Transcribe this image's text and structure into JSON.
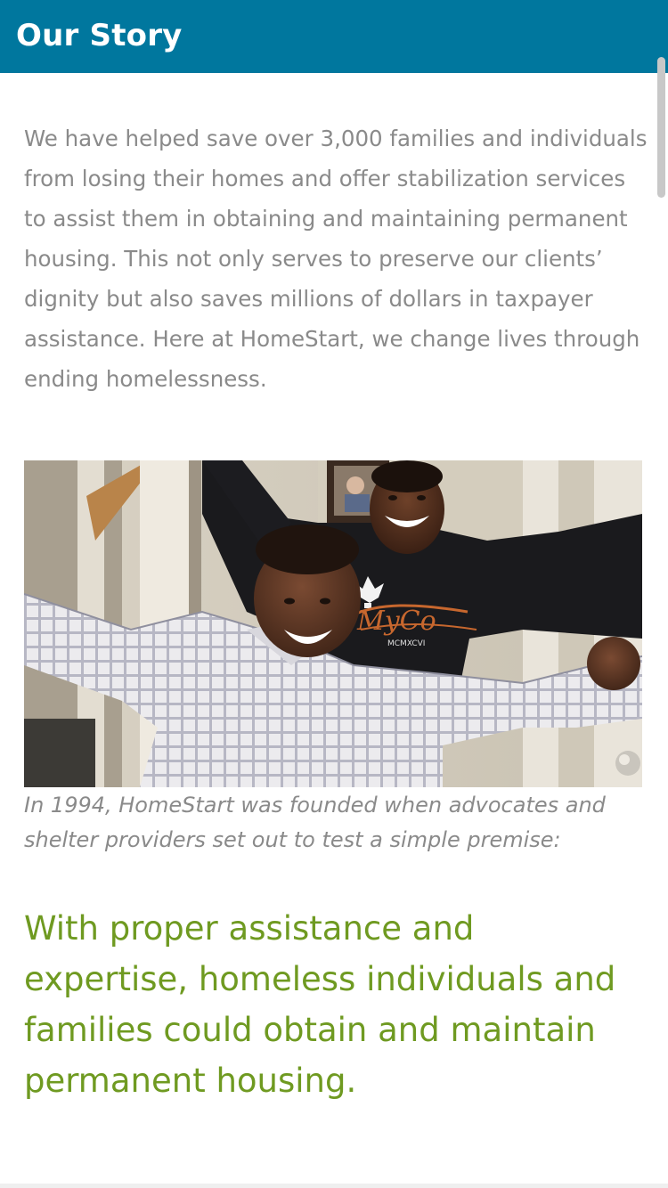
{
  "header": {
    "title": "Our Story"
  },
  "intro": {
    "text": "We have helped save over 3,000 families and individuals from losing their homes and offer stabilization services to assist them in obtaining and maintaining permanent housing. This not only serves to preserve our clients’ dignity but also saves millions of dollars in taxpayer assistance. Here at HomeStart, we change lives through ending homelessness."
  },
  "photo": {
    "shirt_text": "MyCo",
    "shirt_numeral": "MCMXCVI"
  },
  "caption": {
    "text": "In 1994, HomeStart was founded when advocates and shelter providers set out to test a simple premise:"
  },
  "quote": {
    "text": "With proper assistance and expertise, homeless individuals and families could obtain and maintain permanent housing."
  },
  "colors": {
    "header_bg": "#00779e",
    "body_text": "#8a8a8a",
    "quote_text": "#6f9a21"
  }
}
